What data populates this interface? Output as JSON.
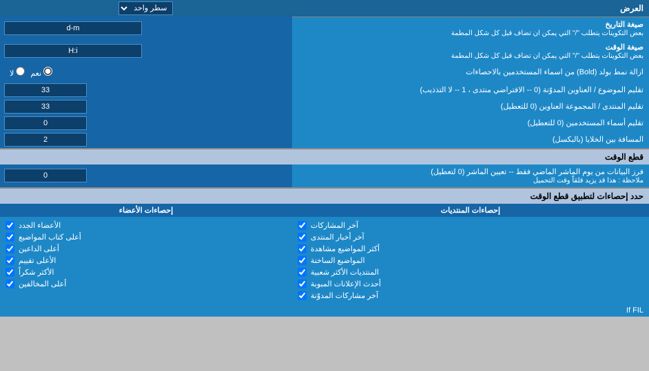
{
  "title": "العرض",
  "header_row": {
    "label": "العرض",
    "dropdown_label": "سطر واحد"
  },
  "date_format_label": "صيغة التاريخ",
  "date_format_note": "بعض التكوينات يتطلب \"/\" التي يمكن ان تضاف قبل كل شكل المطمة",
  "date_format_value": "d-m",
  "time_format_label": "صيغة الوقت",
  "time_format_note": "بعض التكوينات يتطلب \"/\" التي يمكن ان تضاف قبل كل شكل المطمة",
  "time_format_value": "H:i",
  "bold_label": "ازالة نمط بولد (Bold) من اسماء المستخدمين بالاحصاءات",
  "bold_yes": "نعم",
  "bold_no": "لا",
  "title_limit_label": "تقليم الموضوع / العناوين المدوّنة (0 -- الافتراضي منتدى ، 1 -- لا التذذيب)",
  "title_limit_value": "33",
  "forum_limit_label": "تقليم المنتدى / المجموعة العناوين (0 للتعطيل)",
  "forum_limit_value": "33",
  "user_limit_label": "تقليم أسماء المستخدمين (0 للتعطيل)",
  "user_limit_value": "0",
  "cell_spacing_label": "المسافة بين الخلايا (بالبكسل)",
  "cell_spacing_value": "2",
  "cutoff_section": "قطع الوقت",
  "cutoff_label": "فرز البيانات من يوم الماشر الماضي فقط -- تعيين الماشر (0 لتعطيل)",
  "cutoff_note": "ملاحظة : هذا قد يزيد قلقاً وقت التحميل",
  "cutoff_value": "0",
  "stats_section_label": "حدد إحصاءات لتطبيق قطع الوقت",
  "col1_header": "إحصاءات المنتديات",
  "col2_header": "إحصاءات الأعضاء",
  "stats_col1": [
    "آخر المشاركات",
    "آخر أخبار المنتدى",
    "أكثر المواضيع مشاهدة",
    "المواضيع الساخنة",
    "المنتديات الأكثر شعبية",
    "أحدث الإعلانات المبوبة",
    "آخر مشاركات المدوّنة"
  ],
  "stats_col2": [
    "الأعضاء الجدد",
    "أعلى كتاب المواضيع",
    "أعلى الداعين",
    "الأعلى تقييم",
    "الأكثر شكراً",
    "أعلى المخالفين"
  ],
  "if_fil": "If FIL"
}
